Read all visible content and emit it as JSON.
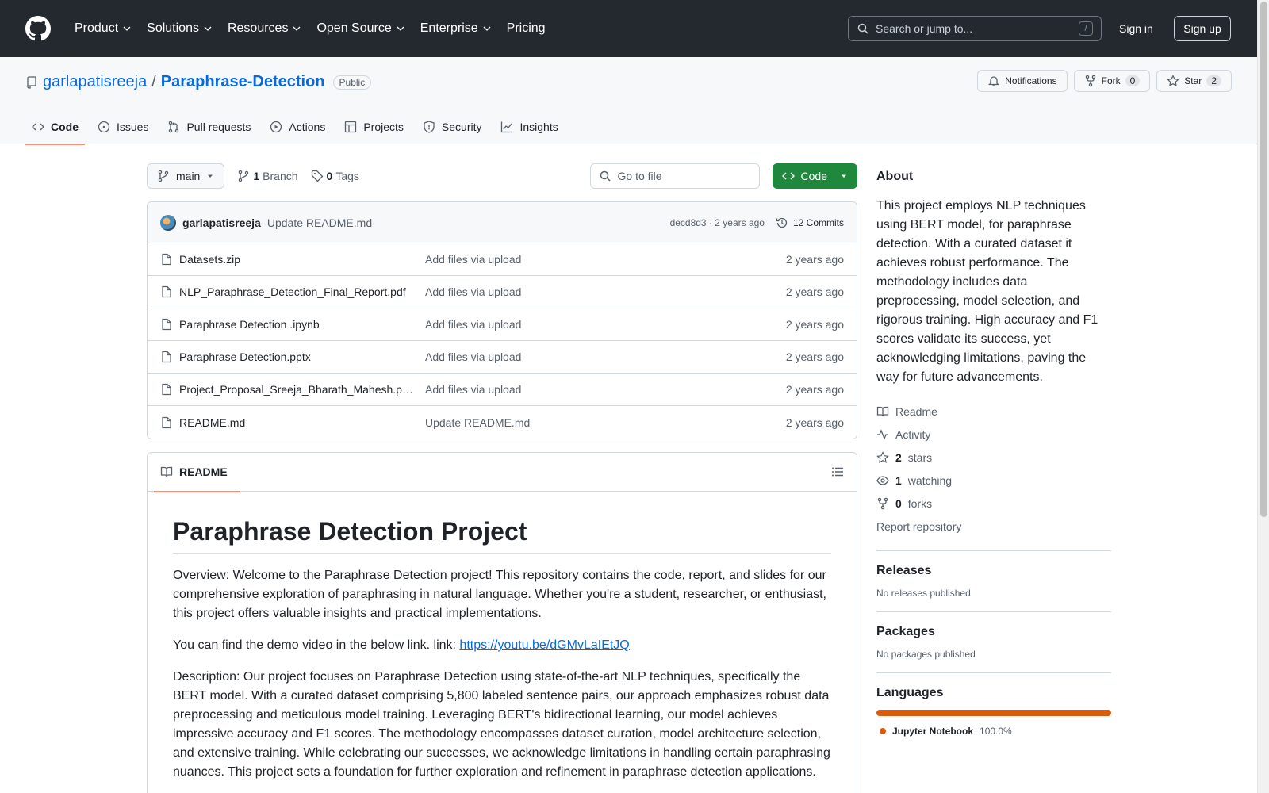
{
  "header": {
    "nav": [
      {
        "label": "Product",
        "has_menu": true
      },
      {
        "label": "Solutions",
        "has_menu": true
      },
      {
        "label": "Resources",
        "has_menu": true
      },
      {
        "label": "Open Source",
        "has_menu": true
      },
      {
        "label": "Enterprise",
        "has_menu": true
      },
      {
        "label": "Pricing",
        "has_menu": false
      }
    ],
    "search_placeholder": "Search or jump to...",
    "search_shortcut": "/",
    "sign_in": "Sign in",
    "sign_up": "Sign up"
  },
  "repo": {
    "owner": "garlapatisreeja",
    "separator": "/",
    "name": "Paraphrase-Detection",
    "visibility": "Public",
    "notifications_label": "Notifications",
    "fork_label": "Fork",
    "fork_count": "0",
    "star_label": "Star",
    "star_count": "2",
    "tabs": [
      {
        "label": "Code",
        "icon": "code-icon"
      },
      {
        "label": "Issues",
        "icon": "issue-icon"
      },
      {
        "label": "Pull requests",
        "icon": "pull-request-icon"
      },
      {
        "label": "Actions",
        "icon": "play-icon"
      },
      {
        "label": "Projects",
        "icon": "table-icon"
      },
      {
        "label": "Security",
        "icon": "shield-icon"
      },
      {
        "label": "Insights",
        "icon": "graph-icon"
      }
    ]
  },
  "toolbar": {
    "branch": "main",
    "branch_count": "1",
    "branch_label": "Branch",
    "tag_count": "0",
    "tag_label": "Tags",
    "goto_placeholder": "Go to file",
    "code_button": "Code"
  },
  "latest_commit": {
    "author": "garlapatisreeja",
    "message": "Update README.md",
    "hash_time": "decd8d3 · 2 years ago",
    "commits_label": "12 Commits"
  },
  "files": [
    {
      "name": "Datasets.zip",
      "message": "Add files via upload",
      "date": "2 years ago"
    },
    {
      "name": "NLP_Paraphrase_Detection_Final_Report.pdf",
      "message": "Add files via upload",
      "date": "2 years ago"
    },
    {
      "name": "Paraphrase Detection .ipynb",
      "message": "Add files via upload",
      "date": "2 years ago"
    },
    {
      "name": "Paraphrase Detection.pptx",
      "message": "Add files via upload",
      "date": "2 years ago"
    },
    {
      "name": "Project_Proposal_Sreeja_Bharath_Mahesh.p…",
      "message": "Add files via upload",
      "date": "2 years ago"
    },
    {
      "name": "README.md",
      "message": "Update README.md",
      "date": "2 years ago"
    }
  ],
  "readme": {
    "tab_label": "README",
    "title": "Paraphrase Detection Project",
    "overview": "Overview: Welcome to the Paraphrase Detection project! This repository contains the code, report, and slides for our comprehensive exploration of paraphrasing in natural language. Whether you're a student, researcher, or enthusiast, this project offers valuable insights and practical implementations.",
    "demo_prefix": "You can find the demo video in the below link. link: ",
    "demo_link": "https://youtu.be/dGMvLaIEtJQ",
    "description": "Description: Our project focuses on Paraphrase Detection using state-of-the-art NLP techniques, specifically the BERT model. With a curated dataset comprising 5,800 labeled sentence pairs, our approach emphasizes robust data preprocessing and meticulous model training. Leveraging BERT's bidirectional learning, our model achieves impressive accuracy and F1 scores. The methodology encompasses dataset curation, model architecture selection, and extensive training. While celebrating our successes, we acknowledge limitations in handling certain paraphrasing nuances. This project sets a foundation for further exploration and refinement in paraphrase detection applications."
  },
  "sidebar": {
    "about_heading": "About",
    "about_text": "This project employs NLP techniques using BERT model, for paraphrase detection. With a curated dataset it achieves robust performance. The methodology includes data preprocessing, model selection, and rigorous training. High accuracy and F1 scores validate its success, yet acknowledging limitations, paving the way for future advancements.",
    "readme_label": "Readme",
    "activity_label": "Activity",
    "stars_count": "2",
    "stars_label": "stars",
    "watching_count": "1",
    "watching_label": "watching",
    "forks_count": "0",
    "forks_label": "forks",
    "report_label": "Report repository",
    "releases_heading": "Releases",
    "releases_text": "No releases published",
    "packages_heading": "Packages",
    "packages_text": "No packages published",
    "languages_heading": "Languages",
    "language_name": "Jupyter Notebook",
    "language_pct": "100.0%",
    "language_color": "#DA5B0B"
  },
  "colors": {
    "header_bg": "#24292F",
    "link": "#0969DA",
    "code_button": "#1F883D",
    "active_tab_underline": "#FD8C73"
  }
}
